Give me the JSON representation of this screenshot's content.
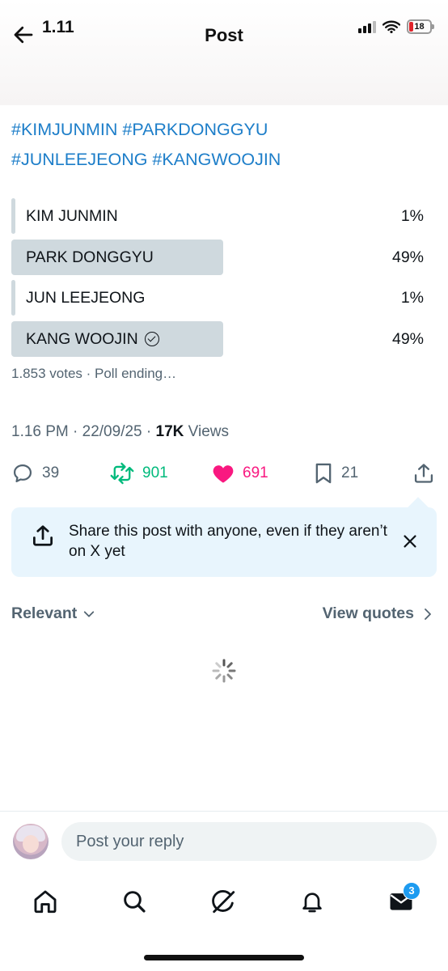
{
  "status_bar": {
    "time": "1.11",
    "battery": "18"
  },
  "header": {
    "title": "Post"
  },
  "post": {
    "hashtags_line1": "#KIMJUNMIN #PARKDONGGYU",
    "hashtags_line2": "#JUNLEEJEONG #KANGWOOJIN",
    "poll": {
      "options": [
        {
          "label": "KIM JUNMIN",
          "percent": "1%",
          "share": 0.01,
          "selected": false
        },
        {
          "label": "PARK DONGGYU",
          "percent": "49%",
          "share": 0.49,
          "selected": false
        },
        {
          "label": "JUN LEEJEONG",
          "percent": "1%",
          "share": 0.01,
          "selected": false
        },
        {
          "label": "KANG WOOJIN",
          "percent": "49%",
          "share": 0.49,
          "selected": true
        }
      ],
      "meta": "1.853 votes · Poll ending…"
    },
    "timestamp": "1.16 PM · 22/09/25 · ",
    "views_count": "17K",
    "views_label": " Views",
    "actions": {
      "replies": "39",
      "reposts": "901",
      "likes": "691",
      "bookmarks": "21"
    },
    "colors": {
      "link": "#1d7ec9",
      "repost": "#00ba7c",
      "like": "#f91880"
    }
  },
  "share_prompt": {
    "text": "Share this post with anyone, even if they aren’t on X yet"
  },
  "replies_header": {
    "sort_label": "Relevant",
    "quotes_label": "View quotes"
  },
  "reply_bar": {
    "placeholder": "Post your reply"
  },
  "bottom_nav": {
    "items": [
      "home-icon",
      "search-icon",
      "grok-icon",
      "notifications-icon",
      "messages-icon"
    ],
    "messages_badge": "3"
  }
}
